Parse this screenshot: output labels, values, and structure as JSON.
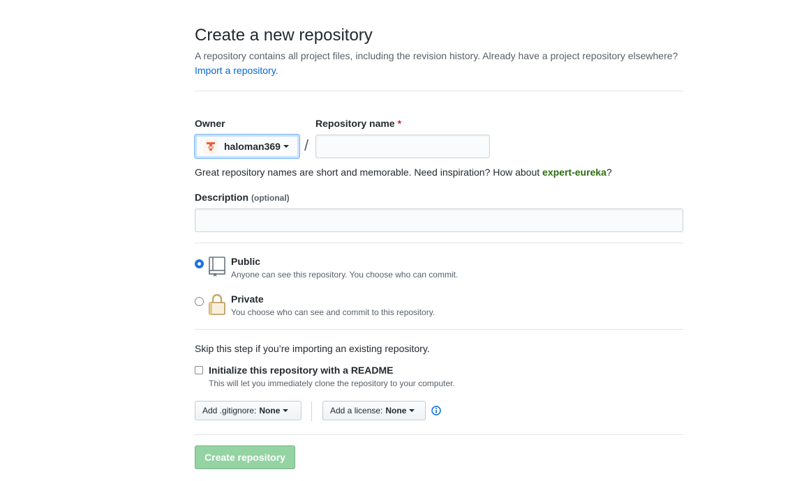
{
  "header": {
    "title": "Create a new repository",
    "subhead_text": "A repository contains all project files, including the revision history. Already have a project repository elsewhere? ",
    "import_link": "Import a repository."
  },
  "owner": {
    "label": "Owner",
    "name": "haloman369"
  },
  "repo_name": {
    "label": "Repository name",
    "required_mark": "*",
    "value": "",
    "separator": "/"
  },
  "hint": {
    "text": "Great repository names are short and memorable. Need inspiration? How about ",
    "suggestion": "expert-eureka",
    "end": "?"
  },
  "description": {
    "label": "Description",
    "optional": "(optional)",
    "value": ""
  },
  "visibility": {
    "public": {
      "title": "Public",
      "desc": "Anyone can see this repository. You choose who can commit."
    },
    "private": {
      "title": "Private",
      "desc": "You choose who can see and commit to this repository."
    },
    "selected": "public"
  },
  "init": {
    "skip_note": "Skip this step if you’re importing an existing repository.",
    "readme_label": "Initialize this repository with a README",
    "readme_desc": "This will let you immediately clone the repository to your computer."
  },
  "gitignore": {
    "label": "Add .gitignore:",
    "value": "None"
  },
  "license": {
    "label": "Add a license:",
    "value": "None"
  },
  "submit": {
    "label": "Create repository"
  },
  "colors": {
    "link": "#0366d6",
    "suggestion": "#2c6e0e",
    "required": "#cb2431",
    "create_disabled": "#94d3a2",
    "radio_checked": "#1a73e8"
  }
}
